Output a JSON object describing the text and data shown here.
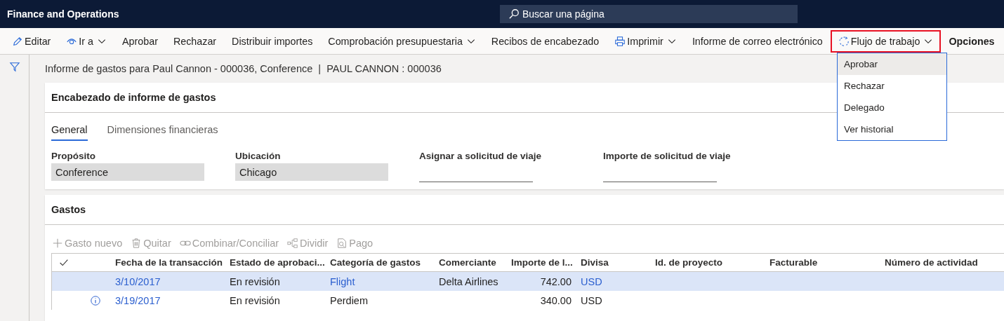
{
  "app_title": "Finance and Operations",
  "search": {
    "placeholder": "Buscar una página"
  },
  "toolbar": [
    {
      "label": "Editar",
      "dropdown": false,
      "highlighted": false,
      "kind": "command"
    },
    {
      "label": "Ir a",
      "dropdown": true,
      "highlighted": false,
      "kind": "command"
    },
    {
      "label": "Aprobar",
      "dropdown": false,
      "highlighted": false,
      "kind": "command"
    },
    {
      "label": "Rechazar",
      "dropdown": false,
      "highlighted": false,
      "kind": "command"
    },
    {
      "label": "Distribuir importes",
      "dropdown": false,
      "highlighted": false,
      "kind": "command"
    },
    {
      "label": "Comprobación presupuestaria",
      "dropdown": true,
      "highlighted": false,
      "kind": "command"
    },
    {
      "label": "Recibos de encabezado",
      "dropdown": false,
      "highlighted": false,
      "kind": "command"
    },
    {
      "label": "Imprimir",
      "dropdown": true,
      "highlighted": false,
      "kind": "command"
    },
    {
      "label": "Informe de correo electrónico",
      "dropdown": false,
      "highlighted": false,
      "kind": "command"
    },
    {
      "label": "Flujo de trabajo",
      "dropdown": true,
      "highlighted": true,
      "kind": "command"
    },
    {
      "label": "Opciones",
      "dropdown": false,
      "highlighted": false,
      "kind": "section"
    }
  ],
  "workflow_menu": [
    {
      "label": "Aprobar",
      "selected": true
    },
    {
      "label": "Rechazar",
      "selected": false
    },
    {
      "label": "Delegado",
      "selected": false
    },
    {
      "label": "Ver historial",
      "selected": false
    }
  ],
  "page_title": "Informe de gastos para Paul Cannon - 000036, Conference  |  PAUL CANNON : 000036",
  "header_card": {
    "title": "Encabezado de informe de gastos",
    "tabs": [
      {
        "label": "General",
        "selected": true
      },
      {
        "label": "Dimensiones financieras",
        "selected": false
      }
    ],
    "fields": [
      {
        "label": "Propósito",
        "value": "Conference",
        "kind": "readonly"
      },
      {
        "label": "Ubicación",
        "value": "Chicago",
        "kind": "readonly"
      },
      {
        "label": "Asignar a solicitud de viaje",
        "kind": "line"
      },
      {
        "label": "Importe de solicitud de viaje",
        "kind": "line"
      }
    ]
  },
  "expenses": {
    "title": "Gastos",
    "actions": [
      {
        "label": "Gasto nuevo",
        "disabled": true
      },
      {
        "label": "Quitar",
        "disabled": true
      },
      {
        "label": "Combinar/Conciliar",
        "disabled": true
      },
      {
        "label": "Dividir",
        "disabled": true
      },
      {
        "label": "Pago",
        "disabled": true
      }
    ],
    "columns": [
      "Fecha de la transacción",
      "Estado de aprobaci...",
      "Categoría de gastos",
      "Comerciante",
      "Importe de l...",
      "Divisa",
      "Id. de proyecto",
      "Facturable",
      "Número de actividad"
    ],
    "rows": [
      {
        "selected": true,
        "info": false,
        "cells": [
          {
            "text": "3/10/2017",
            "kind": "link"
          },
          {
            "text": "En revisión",
            "kind": "text"
          },
          {
            "text": "Flight",
            "kind": "link"
          },
          {
            "text": "Delta Airlines",
            "kind": "text"
          },
          {
            "text": "742.00",
            "kind": "text"
          },
          {
            "text": "USD",
            "kind": "link"
          }
        ]
      },
      {
        "selected": false,
        "info": true,
        "cells": [
          {
            "text": "3/19/2017",
            "kind": "link"
          },
          {
            "text": "En revisión",
            "kind": "text"
          },
          {
            "text": "Perdiem",
            "kind": "text"
          },
          null,
          {
            "text": "340.00",
            "kind": "text"
          },
          {
            "text": "USD",
            "kind": "text"
          }
        ]
      }
    ]
  }
}
